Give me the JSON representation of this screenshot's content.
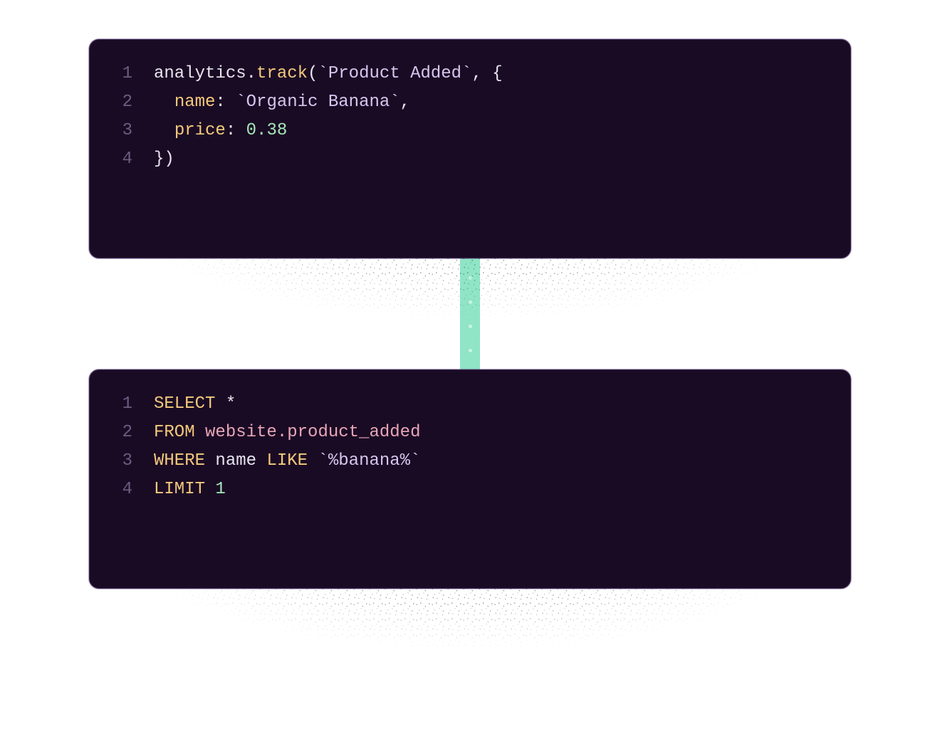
{
  "colors": {
    "card_bg": "#1a0b24",
    "card_border": "#3a2850",
    "connector": "#8fe5c6",
    "line_number": "#6b5d82",
    "token_default": "#e8e4f0",
    "token_method": "#f5c97d",
    "token_string": "#d5c8f0",
    "token_prop": "#f5c97d",
    "token_number": "#a5e8b8",
    "token_keyword": "#f5c97d",
    "token_ident": "#e8a5b8"
  },
  "blocks": [
    {
      "id": "js-block",
      "language": "javascript",
      "lines": [
        {
          "n": "1",
          "tokens": [
            {
              "t": "analytics",
              "c": "tok-default"
            },
            {
              "t": ".",
              "c": "tok-punct"
            },
            {
              "t": "track",
              "c": "tok-method"
            },
            {
              "t": "(",
              "c": "tok-punct"
            },
            {
              "t": "`Product Added`",
              "c": "tok-string"
            },
            {
              "t": ", {",
              "c": "tok-punct"
            }
          ]
        },
        {
          "n": "2",
          "tokens": [
            {
              "t": "  ",
              "c": "tok-default"
            },
            {
              "t": "name",
              "c": "tok-prop"
            },
            {
              "t": ": ",
              "c": "tok-punct"
            },
            {
              "t": "`Organic Banana`",
              "c": "tok-string"
            },
            {
              "t": ",",
              "c": "tok-punct"
            }
          ]
        },
        {
          "n": "3",
          "tokens": [
            {
              "t": "  ",
              "c": "tok-default"
            },
            {
              "t": "price",
              "c": "tok-prop"
            },
            {
              "t": ": ",
              "c": "tok-punct"
            },
            {
              "t": "0.38",
              "c": "tok-number"
            }
          ]
        },
        {
          "n": "4",
          "tokens": [
            {
              "t": "})",
              "c": "tok-punct"
            }
          ]
        }
      ]
    },
    {
      "id": "sql-block",
      "language": "sql",
      "lines": [
        {
          "n": "1",
          "tokens": [
            {
              "t": "SELECT",
              "c": "tok-keyword"
            },
            {
              "t": " *",
              "c": "tok-default"
            }
          ]
        },
        {
          "n": "2",
          "tokens": [
            {
              "t": "FROM",
              "c": "tok-keyword"
            },
            {
              "t": " ",
              "c": "tok-default"
            },
            {
              "t": "website.product_added",
              "c": "tok-ident"
            }
          ]
        },
        {
          "n": "3",
          "tokens": [
            {
              "t": "WHERE",
              "c": "tok-keyword"
            },
            {
              "t": " name ",
              "c": "tok-default"
            },
            {
              "t": "LIKE",
              "c": "tok-keyword"
            },
            {
              "t": " ",
              "c": "tok-default"
            },
            {
              "t": "`%banana%`",
              "c": "tok-string"
            }
          ]
        },
        {
          "n": "4",
          "tokens": [
            {
              "t": "LIMIT",
              "c": "tok-keyword"
            },
            {
              "t": " ",
              "c": "tok-default"
            },
            {
              "t": "1",
              "c": "tok-number"
            }
          ]
        }
      ]
    }
  ]
}
